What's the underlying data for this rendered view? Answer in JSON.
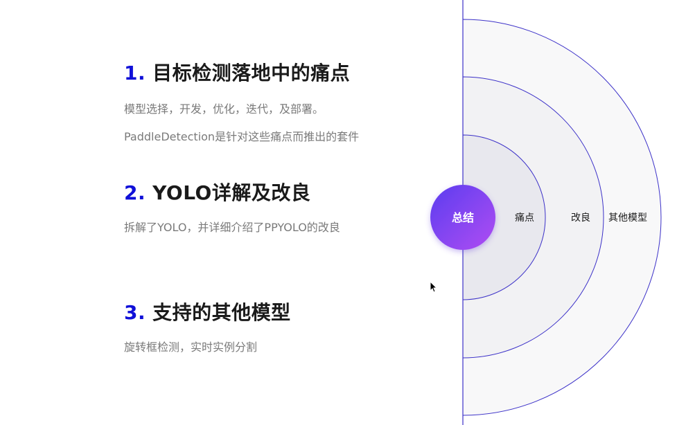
{
  "sections": [
    {
      "number": "1.",
      "title": "目标检测落地中的痛点",
      "lines": [
        "模型选择，开发，优化，迭代，及部署。",
        "PaddleDetection是针对这些痛点而推出的套件"
      ]
    },
    {
      "number": "2.",
      "title": "YOLO详解及改良",
      "lines": [
        "拆解了YOLO，并详细介绍了PPYOLO的改良"
      ]
    },
    {
      "number": "3.",
      "title": "支持的其他模型",
      "lines": [
        "旋转框检测，实时实例分割"
      ]
    }
  ],
  "diagram": {
    "center_label": "总结",
    "rings": [
      "痛点",
      "改良",
      "其他模型"
    ],
    "colors": {
      "line": "#3b30c8",
      "ring_inner_fill": "#e8e8ee",
      "ring_middle_fill": "#f2f2f4",
      "ring_outer_fill": "#f8f8f9",
      "center_grad_start": "#5b3ef0",
      "center_grad_end": "#b04cf2"
    }
  }
}
